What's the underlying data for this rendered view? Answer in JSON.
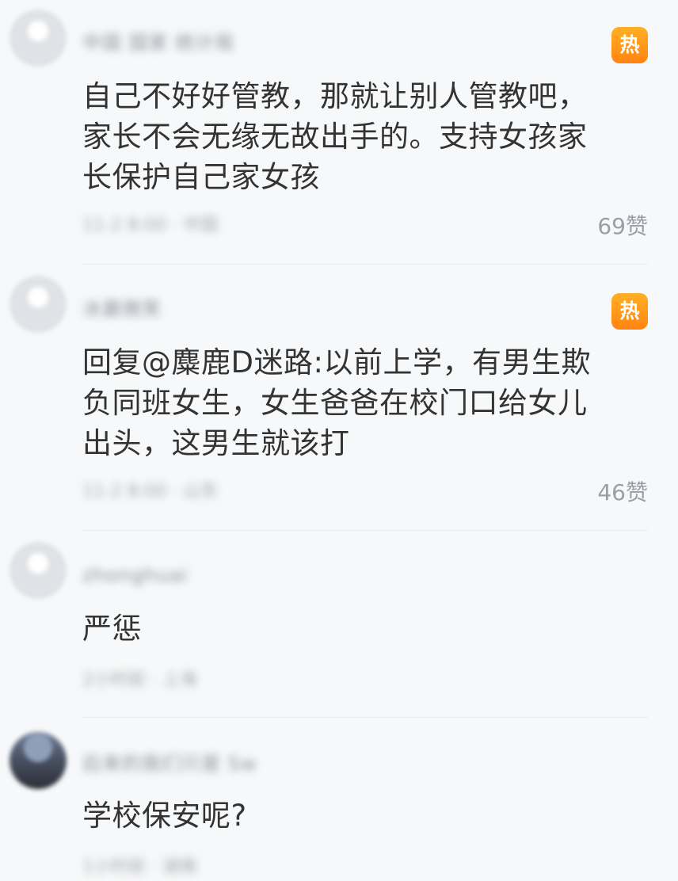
{
  "comments": [
    {
      "username": "中国 国家 统计局",
      "hot_label": "热",
      "text_lines": [
        "自己不好好管教，那就让别人管教吧，",
        "家长不会无缘无故出手的。支持女孩家",
        "长保护自己家女孩"
      ],
      "meta": "11-2 8:00 · 中国",
      "likes": "69赞"
    },
    {
      "username": "冰晨微笑",
      "hot_label": "热",
      "text_lines": [
        "回复@麋鹿D迷路:以前上学，有男生欺",
        "负同班女生，女生爸爸在校门口给女儿",
        "出头，这男生就该打"
      ],
      "meta": "11-2 8:00 · 山东",
      "likes": "46赞"
    },
    {
      "username": "zhonghuai",
      "text_lines": [
        "严惩"
      ],
      "meta": "2小时前 · 上海"
    },
    {
      "username": "后来的我们只是 Sw",
      "text_lines": [
        "学校保安呢?"
      ],
      "meta": "1小时前 · 湖南"
    }
  ],
  "colors": {
    "background": "#f7f8f9",
    "hot_badge": "#ff9a18",
    "text": "#333333",
    "muted": "#9a9ea6"
  },
  "icons": {
    "hot": "hot-badge-icon",
    "avatar": "avatar-icon"
  }
}
